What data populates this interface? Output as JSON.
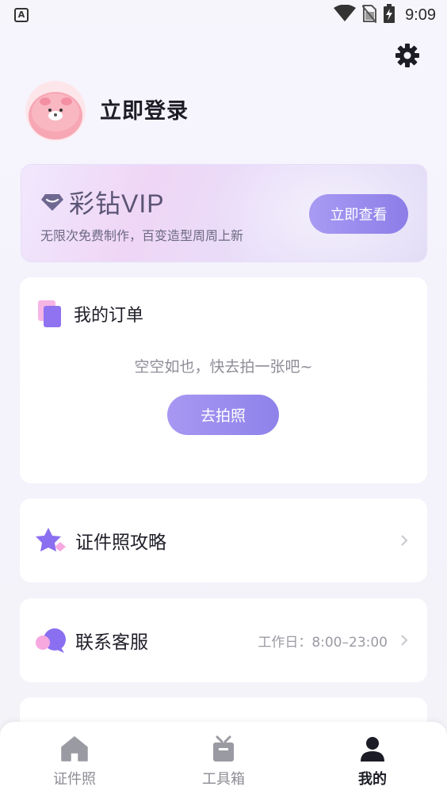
{
  "status_bar": {
    "app_icon_letter": "A",
    "time": "9:09"
  },
  "profile": {
    "login_label": "立即登录"
  },
  "vip_card": {
    "title": "彩钻VIP",
    "subtitle": "无限次免费制作，百变造型周周上新",
    "button_label": "立即查看"
  },
  "orders": {
    "title": "我的订单",
    "empty_text": "空空如也，快去拍一张吧~",
    "button_label": "去拍照"
  },
  "menu": [
    {
      "label": "证件照攻略",
      "icon": "star-icon",
      "extra": ""
    },
    {
      "label": "联系客服",
      "icon": "chat-icon",
      "extra": "工作日：8:00–23:00"
    }
  ],
  "bottom_nav": [
    {
      "label": "证件照",
      "icon": "home-icon",
      "active": false
    },
    {
      "label": "工具箱",
      "icon": "toolbox-icon",
      "active": false
    },
    {
      "label": "我的",
      "icon": "person-icon",
      "active": true
    }
  ],
  "colors": {
    "accent": "#8e82ea",
    "vip_text": "#5b5575",
    "background": "#f5f3fb"
  }
}
